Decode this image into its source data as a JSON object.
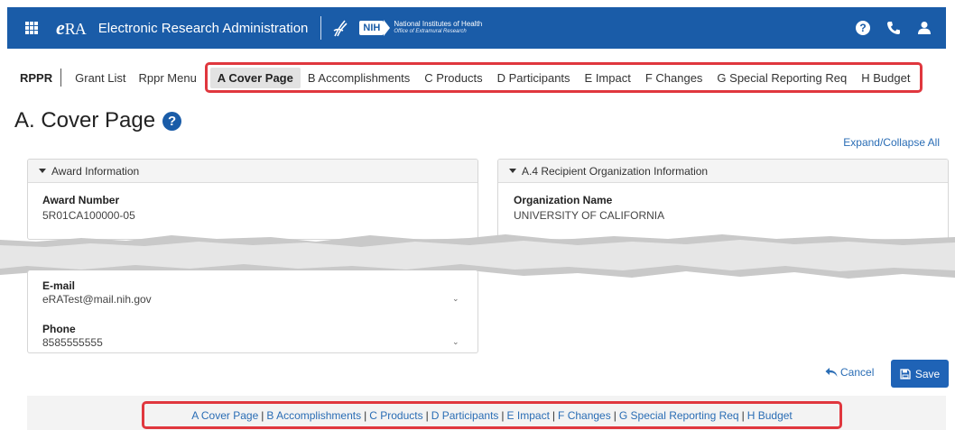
{
  "header": {
    "logo_text": "eRA",
    "app_title": "Electronic Research Administration",
    "nih_abbr": "NIH",
    "nih_name": "National Institutes of Health",
    "nih_office": "Office of Extramural Research",
    "icons": [
      "apps-grid-icon",
      "hhs-logo-icon",
      "help-icon",
      "phone-icon",
      "user-icon"
    ]
  },
  "nav": {
    "section": "RPPR",
    "grant_list": "Grant List",
    "rppr_menu": "Rppr Menu",
    "tabs": [
      {
        "label": "A Cover Page",
        "active": true
      },
      {
        "label": "B Accomplishments"
      },
      {
        "label": "C Products"
      },
      {
        "label": "D Participants"
      },
      {
        "label": "E Impact"
      },
      {
        "label": "F Changes"
      },
      {
        "label": "G Special Reporting Req"
      },
      {
        "label": "H Budget"
      }
    ]
  },
  "page": {
    "title": "A. Cover Page",
    "expand_collapse": "Expand/Collapse All"
  },
  "award_panel": {
    "header": "Award Information",
    "award_number_label": "Award Number",
    "award_number_value": "5R01CA100000-05"
  },
  "org_panel": {
    "header": "A.4 Recipient Organization Information",
    "org_name_label": "Organization Name",
    "org_name_value": "UNIVERSITY OF CALIFORNIA"
  },
  "contact": {
    "email_label": "E-mail",
    "email_value": "eRATest@mail.nih.gov",
    "phone_label": "Phone",
    "phone_value": "8585555555"
  },
  "actions": {
    "cancel": "Cancel",
    "save": "Save"
  },
  "footer_nav": [
    "A Cover Page",
    "B Accomplishments",
    "C Products",
    "D Participants",
    "E Impact",
    "F Changes",
    "G Special Reporting Req",
    "H Budget"
  ],
  "colors": {
    "brand_blue": "#1a5ca8",
    "link_blue": "#2a6db5",
    "highlight_red": "#e0373e"
  }
}
